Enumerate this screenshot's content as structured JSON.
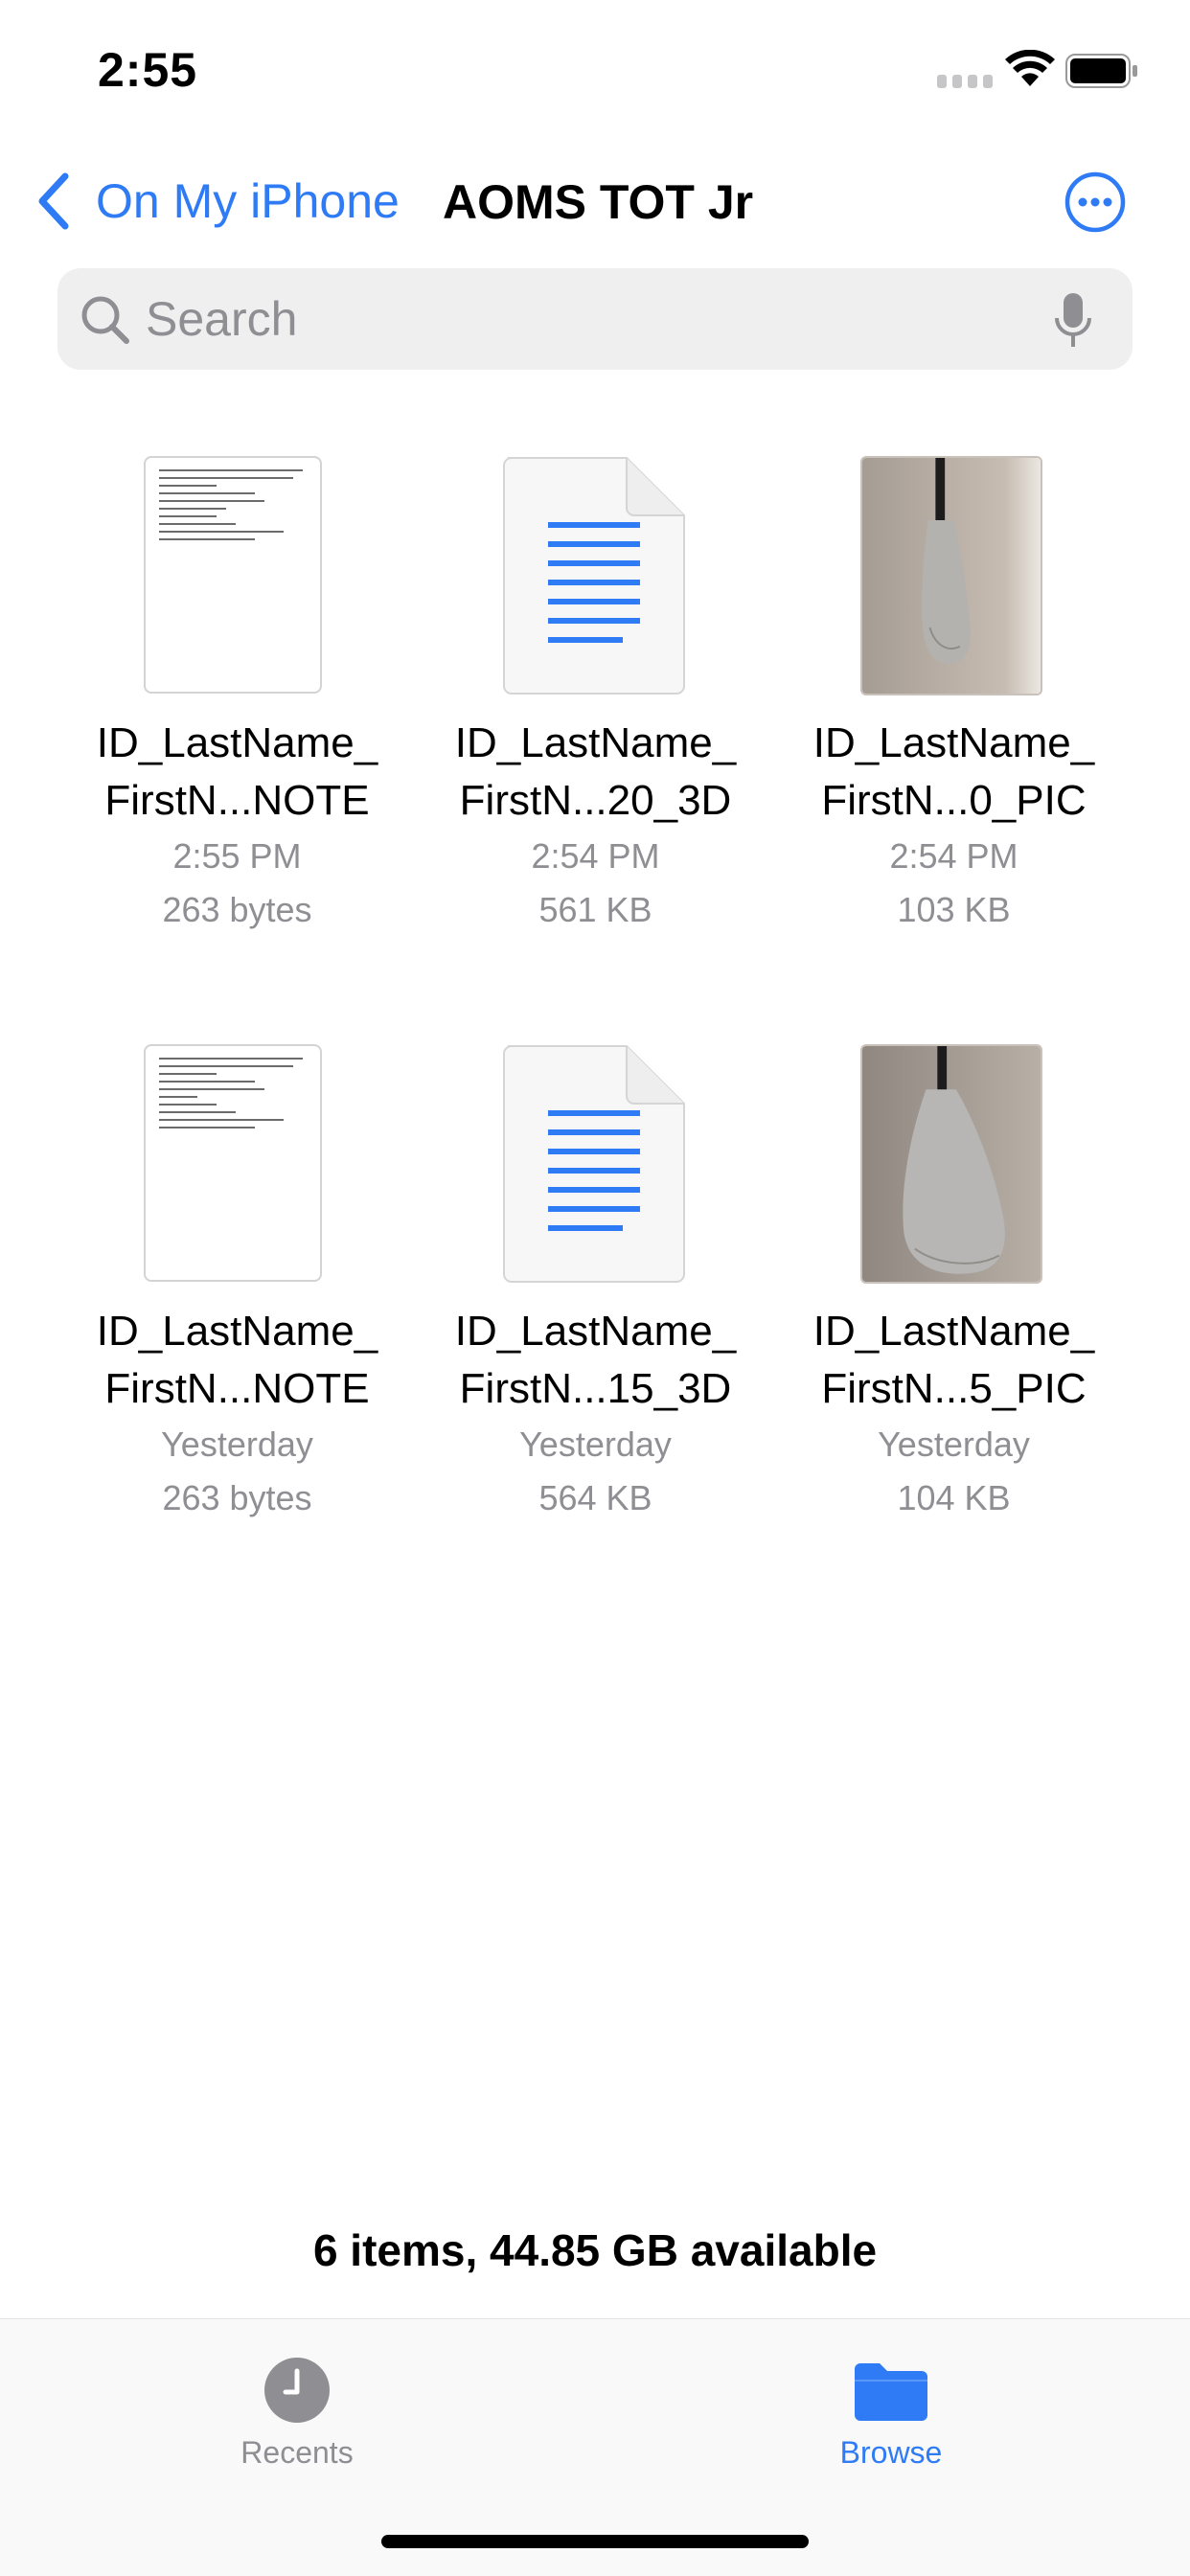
{
  "status_bar": {
    "time": "2:55"
  },
  "nav": {
    "back_label": "On My iPhone",
    "title": "AOMS TOT Jr"
  },
  "search": {
    "placeholder": "Search"
  },
  "files": [
    {
      "name_line1": "ID_LastName_",
      "name_line2": "FirstN...NOTE",
      "date": "2:55 PM",
      "size": "263 bytes",
      "kind": "note-thumbnail"
    },
    {
      "name_line1": "ID_LastName_",
      "name_line2": "FirstN...20_3D",
      "date": "2:54 PM",
      "size": "561 KB",
      "kind": "document-icon"
    },
    {
      "name_line1": "ID_LastName_",
      "name_line2": "FirstN...0_PIC",
      "date": "2:54 PM",
      "size": "103 KB",
      "kind": "photo-thumbnail"
    },
    {
      "name_line1": "ID_LastName_",
      "name_line2": "FirstN...NOTE",
      "date": "Yesterday",
      "size": "263 bytes",
      "kind": "note-thumbnail"
    },
    {
      "name_line1": "ID_LastName_",
      "name_line2": "FirstN...15_3D",
      "date": "Yesterday",
      "size": "564 KB",
      "kind": "document-icon"
    },
    {
      "name_line1": "ID_LastName_",
      "name_line2": "FirstN...5_PIC",
      "date": "Yesterday",
      "size": "104 KB",
      "kind": "photo-thumbnail"
    }
  ],
  "footer": {
    "storage": "6 items, 44.85 GB available"
  },
  "tabs": [
    {
      "label": "Recents",
      "icon": "clock-icon",
      "active": false
    },
    {
      "label": "Browse",
      "icon": "folder-icon",
      "active": true
    }
  ],
  "colors": {
    "accent": "#2f7bf5",
    "secondary_text": "#8e8e93",
    "inactive_tab": "#8e8e93"
  }
}
